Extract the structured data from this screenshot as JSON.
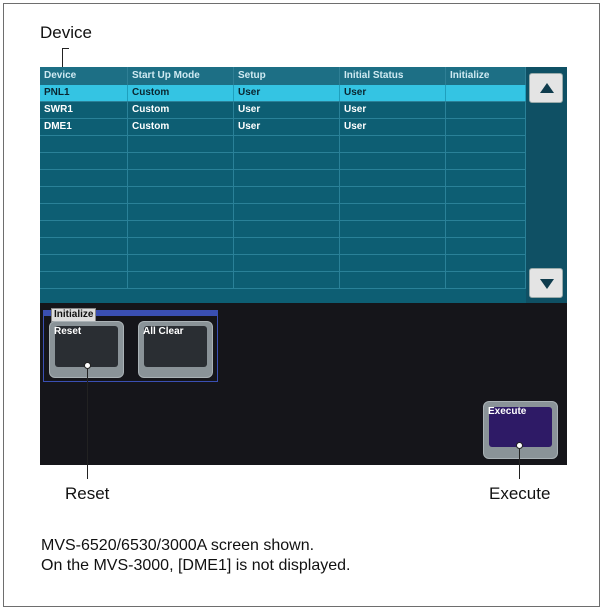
{
  "callouts": {
    "device": "Device",
    "reset": "Reset",
    "execute": "Execute"
  },
  "table": {
    "headers": [
      "Device",
      "Start Up Mode",
      "Setup",
      "Initial Status",
      "Initialize"
    ],
    "rows": [
      [
        "PNL1",
        "Custom",
        "User",
        "User",
        ""
      ],
      [
        "SWR1",
        "Custom",
        "User",
        "User",
        ""
      ],
      [
        "DME1",
        "Custom",
        "User",
        "User",
        ""
      ]
    ],
    "selected_row": 0,
    "empty_rows": 9
  },
  "scroll": {
    "up_icon": "triangle-up-icon",
    "down_icon": "triangle-down-icon"
  },
  "initialize_panel": {
    "title": "Initialize",
    "reset_label": "Reset",
    "all_clear_label": "All Clear"
  },
  "execute_label": "Execute",
  "notes": {
    "line1": "MVS-6520/6530/3000A screen shown.",
    "line2": "On the MVS-3000, [DME1] is not displayed."
  },
  "colors": {
    "table_bg": "#0d5e73",
    "selected_row": "#34c4e3",
    "execute_face": "#2e1a66",
    "panel_border": "#3a4fb3"
  }
}
